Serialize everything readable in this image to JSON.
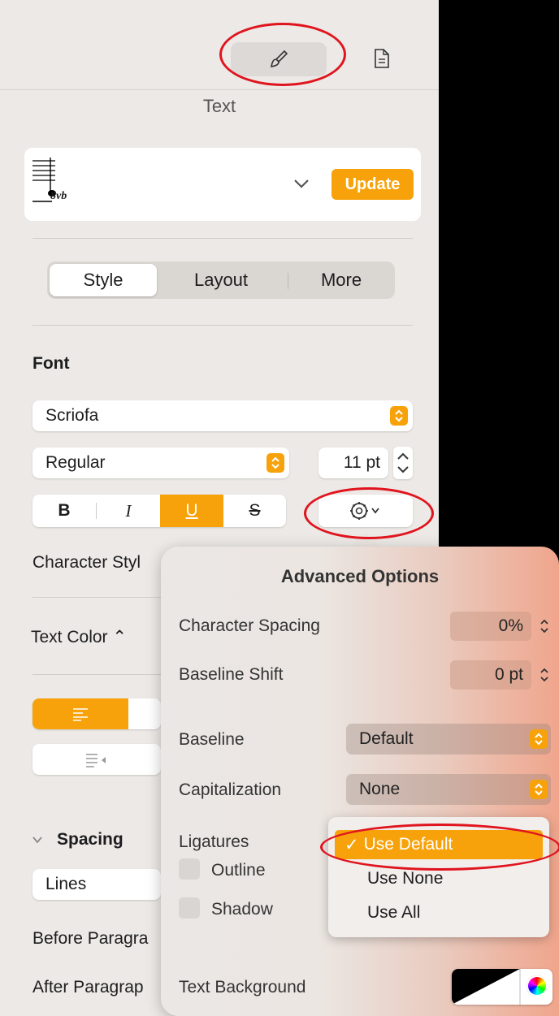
{
  "toolbar": {
    "format_icon": "paintbrush-icon",
    "document_icon": "document-icon"
  },
  "inspector": {
    "section_title": "Text",
    "paragraph_style": {
      "update_label": "Update",
      "thumbnail_text": "8vb"
    },
    "tabs": [
      {
        "label": "Style",
        "active": true
      },
      {
        "label": "Layout",
        "active": false
      },
      {
        "label": "More",
        "active": false
      }
    ],
    "font": {
      "heading": "Font",
      "family": "Scriofa",
      "typeface": "Regular",
      "size": "11 pt",
      "bold": "B",
      "italic": "I",
      "underline": "U",
      "strike": "S",
      "underline_active": true
    },
    "character_style_label": "Character Styl",
    "text_color_label": "Text Color ⌃",
    "spacing": {
      "heading": "Spacing",
      "lines_value": "Lines"
    },
    "before_paragraph_label": "Before Paragra",
    "after_paragraph_label": "After Paragrap"
  },
  "advanced_options": {
    "title": "Advanced Options",
    "character_spacing": {
      "label": "Character Spacing",
      "value": "0%"
    },
    "baseline_shift": {
      "label": "Baseline Shift",
      "value": "0 pt"
    },
    "baseline": {
      "label": "Baseline",
      "value": "Default"
    },
    "capitalization": {
      "label": "Capitalization",
      "value": "None"
    },
    "ligatures": {
      "label": "Ligatures",
      "options": [
        {
          "label": "Use Default",
          "selected": true
        },
        {
          "label": "Use None",
          "selected": false
        },
        {
          "label": "Use All",
          "selected": false
        }
      ]
    },
    "outline_label": "Outline",
    "shadow_label": "Shadow",
    "text_background_label": "Text Background"
  },
  "colors": {
    "accent": "#f7a20a",
    "annotation": "#e0141e"
  }
}
